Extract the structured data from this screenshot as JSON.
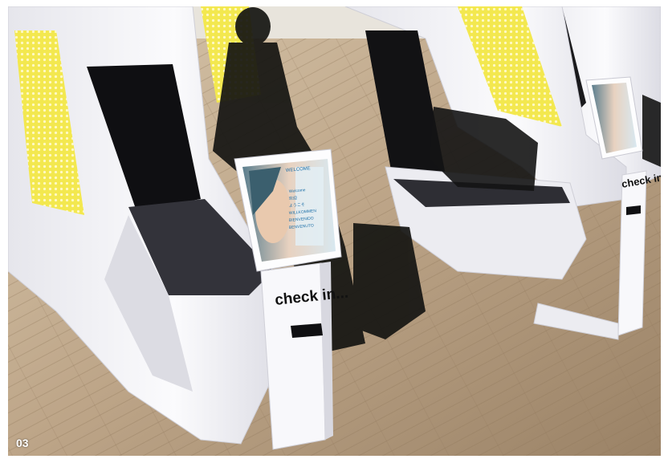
{
  "scene": {
    "figure_number": "03",
    "kiosk_front": {
      "screen_title": "WELCOME",
      "screen_lines": [
        "Welcome",
        "欢迎",
        "ようこそ",
        "WILLKOMMEN",
        "BIENVENIDO",
        "BENVENUTO"
      ],
      "stand_label": "check in..."
    },
    "kiosk_back": {
      "stand_label": "check in..."
    },
    "colors": {
      "floor": "#b49d7f",
      "pod_white": "#f1f1f3",
      "pod_shadow": "#d4d4dc",
      "glow_yellow": "#f4ec5a",
      "seat_dark": "#35353b",
      "silhouette": "#151512"
    }
  }
}
